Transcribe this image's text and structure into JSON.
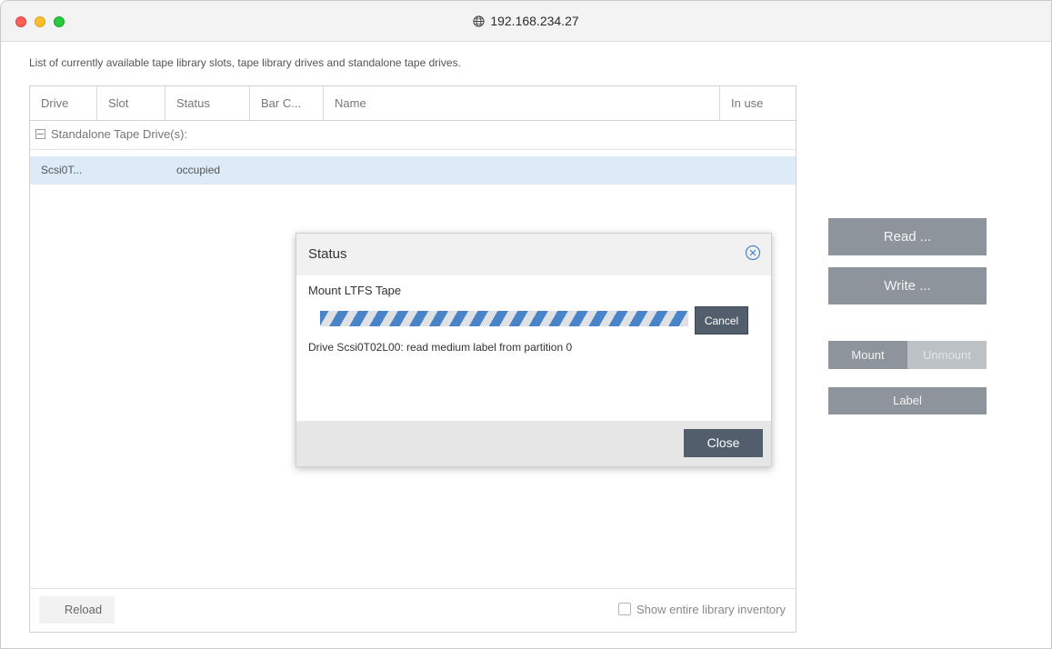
{
  "window": {
    "title": "192.168.234.27"
  },
  "description": "List of currently available tape library slots, tape library drives and standalone tape drives.",
  "table": {
    "columns": [
      "Drive",
      "Slot",
      "Status",
      "Bar C...",
      "Name",
      "In use"
    ],
    "group_label": "Standalone Tape Drive(s):",
    "rows": [
      {
        "drive": "Scsi0T...",
        "slot": "",
        "status": "occupied",
        "barcode": "",
        "name": "",
        "in_use": ""
      }
    ]
  },
  "footer": {
    "reload_label": "Reload",
    "show_inventory_label": "Show entire library inventory",
    "show_inventory_checked": false
  },
  "actions": {
    "read_label": "Read ...",
    "write_label": "Write ...",
    "mount_label": "Mount",
    "unmount_label": "Unmount",
    "label_label": "Label"
  },
  "dialog": {
    "title": "Status",
    "subtitle": "Mount LTFS Tape",
    "cancel_label": "Cancel",
    "message": "Drive Scsi0T02L00: read medium label from partition 0",
    "close_label": "Close",
    "progress_indeterminate": true
  },
  "colors": {
    "selected_row": "#dcebf7",
    "button_gray": "#8e949b",
    "button_disabled": "#bcc1c6",
    "dialog_button": "#525e6b",
    "progress_stripe": "#4a84c8"
  },
  "icons": [
    "globe-icon",
    "collapse-icon",
    "checkbox-icon",
    "close-circle-icon"
  ]
}
